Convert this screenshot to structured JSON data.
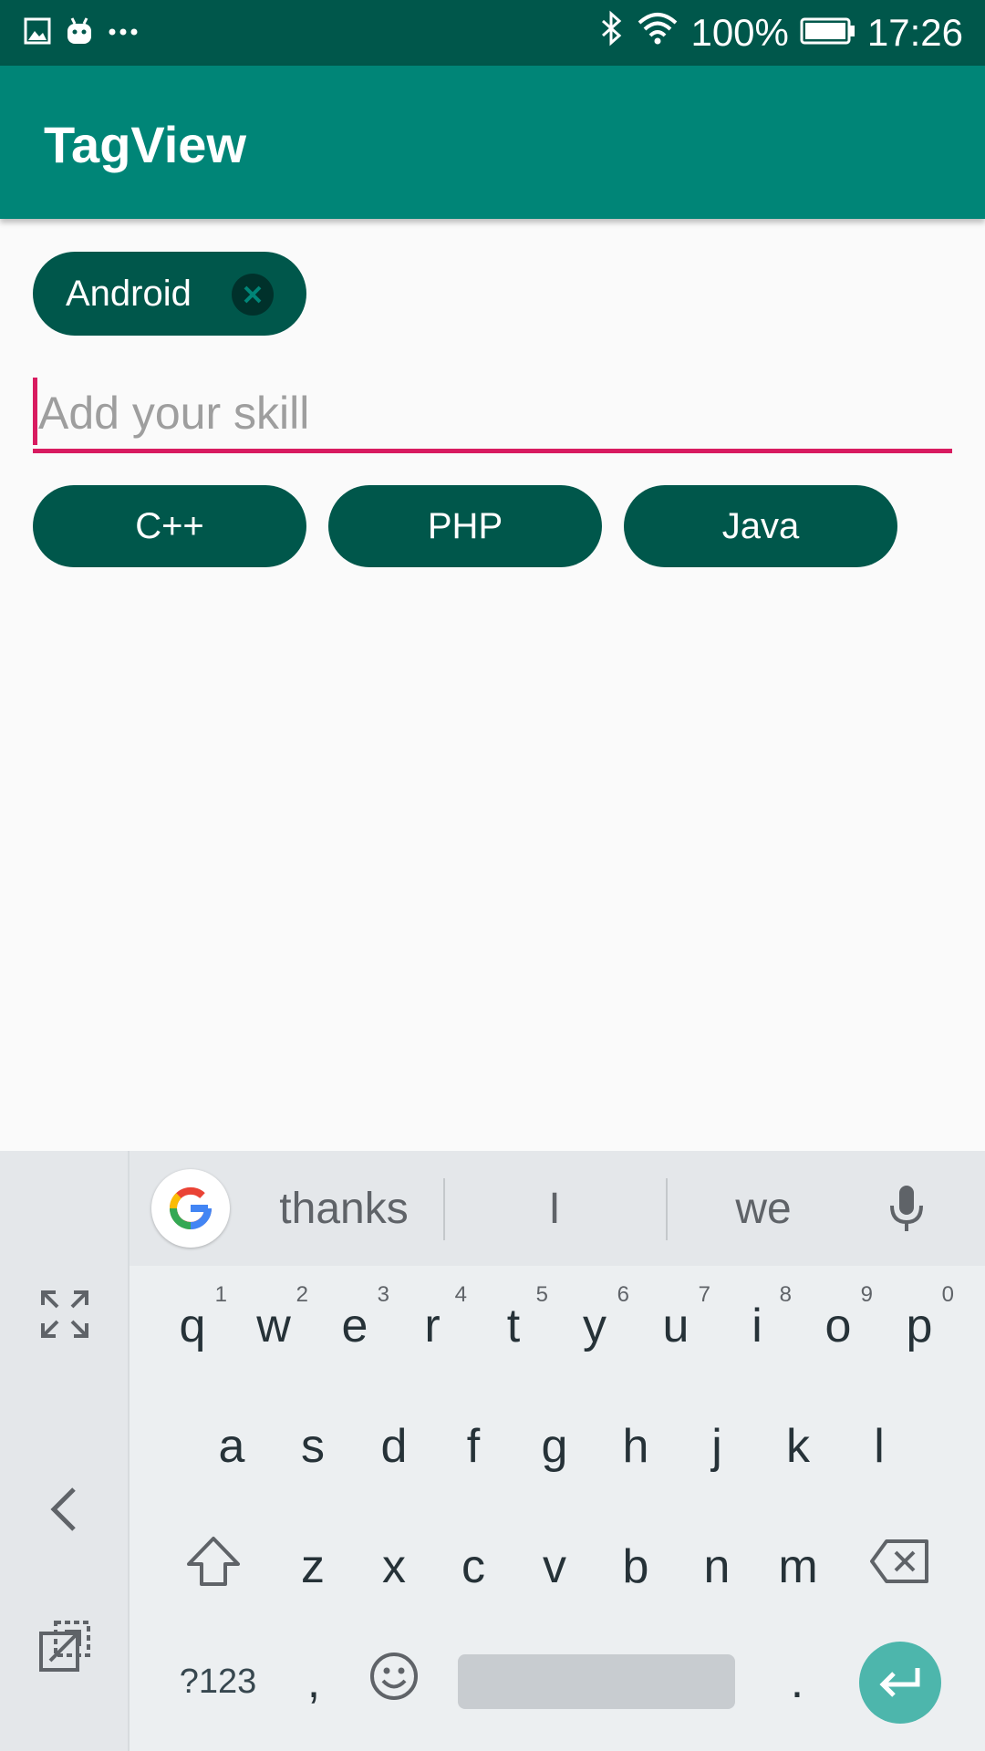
{
  "status_bar": {
    "battery_percent": "100%",
    "time": "17:26",
    "left_icons": [
      "gallery-icon",
      "android-icon",
      "more-dots-icon"
    ],
    "right_icons": [
      "bluetooth-icon",
      "wifi-icon",
      "battery-icon"
    ]
  },
  "app_bar": {
    "title": "TagView"
  },
  "selected_tags": [
    {
      "label": "Android",
      "removable": true
    }
  ],
  "skill_input": {
    "placeholder": "Add your skill",
    "value": ""
  },
  "suggested_tags": [
    {
      "label": "C++"
    },
    {
      "label": "PHP"
    },
    {
      "label": "Java"
    }
  ],
  "keyboard": {
    "suggestions": [
      "thanks",
      "I",
      "we"
    ],
    "row1": [
      "q",
      "w",
      "e",
      "r",
      "t",
      "y",
      "u",
      "i",
      "o",
      "p"
    ],
    "row1_hints": [
      "1",
      "2",
      "3",
      "4",
      "5",
      "6",
      "7",
      "8",
      "9",
      "0"
    ],
    "row2": [
      "a",
      "s",
      "d",
      "f",
      "g",
      "h",
      "j",
      "k",
      "l"
    ],
    "row3": [
      "z",
      "x",
      "c",
      "v",
      "b",
      "n",
      "m"
    ],
    "symbols_label": "?123",
    "comma_label": ",",
    "period_label": "."
  },
  "colors": {
    "status_bar": "#00574b",
    "app_bar": "#008577",
    "chip": "#00574b",
    "accent": "#d81b60",
    "enter": "#4db6ac"
  }
}
